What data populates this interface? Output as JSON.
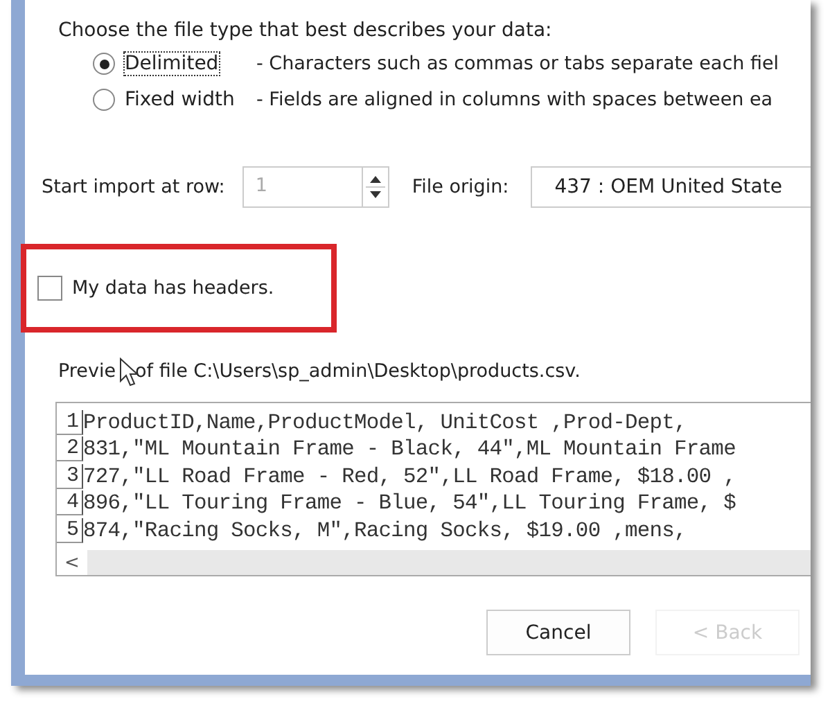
{
  "file_type": {
    "prompt": "Choose the file type that best describes your data:",
    "options": [
      {
        "label": "Delimited",
        "description": "- Characters such as commas or tabs separate each fiel",
        "selected": true,
        "focused": true
      },
      {
        "label": "Fixed width",
        "description": "- Fields are aligned in columns with spaces between ea",
        "selected": false,
        "focused": false
      }
    ]
  },
  "start_row": {
    "label": "Start import at row:",
    "value": "1"
  },
  "file_origin": {
    "label": "File origin:",
    "value": "437 : OEM United State"
  },
  "headers_checkbox": {
    "label": "My data has headers.",
    "checked": false,
    "highlighted": true
  },
  "preview": {
    "caption_start": "Previe",
    "caption_rest": "of file C:\\Users\\sp_admin\\Desktop\\products.csv.",
    "lines": [
      {
        "number": "1",
        "text": "ProductID,Name,ProductModel, UnitCost ,Prod-Dept,"
      },
      {
        "number": "2",
        "text": "831,\"ML Mountain Frame - Black, 44\",ML Mountain Frame"
      },
      {
        "number": "3",
        "text": "727,\"LL Road Frame - Red, 52\",LL Road Frame, $18.00 ,"
      },
      {
        "number": "4",
        "text": "896,\"LL Touring Frame - Blue, 54\",LL Touring Frame, $"
      },
      {
        "number": "5",
        "text": "874,\"Racing Socks, M\",Racing Socks, $19.00 ,mens,"
      }
    ],
    "scroll_left": "<"
  },
  "buttons": [
    {
      "label": "Cancel",
      "disabled": false
    },
    {
      "label": "< Back",
      "disabled": true
    }
  ]
}
